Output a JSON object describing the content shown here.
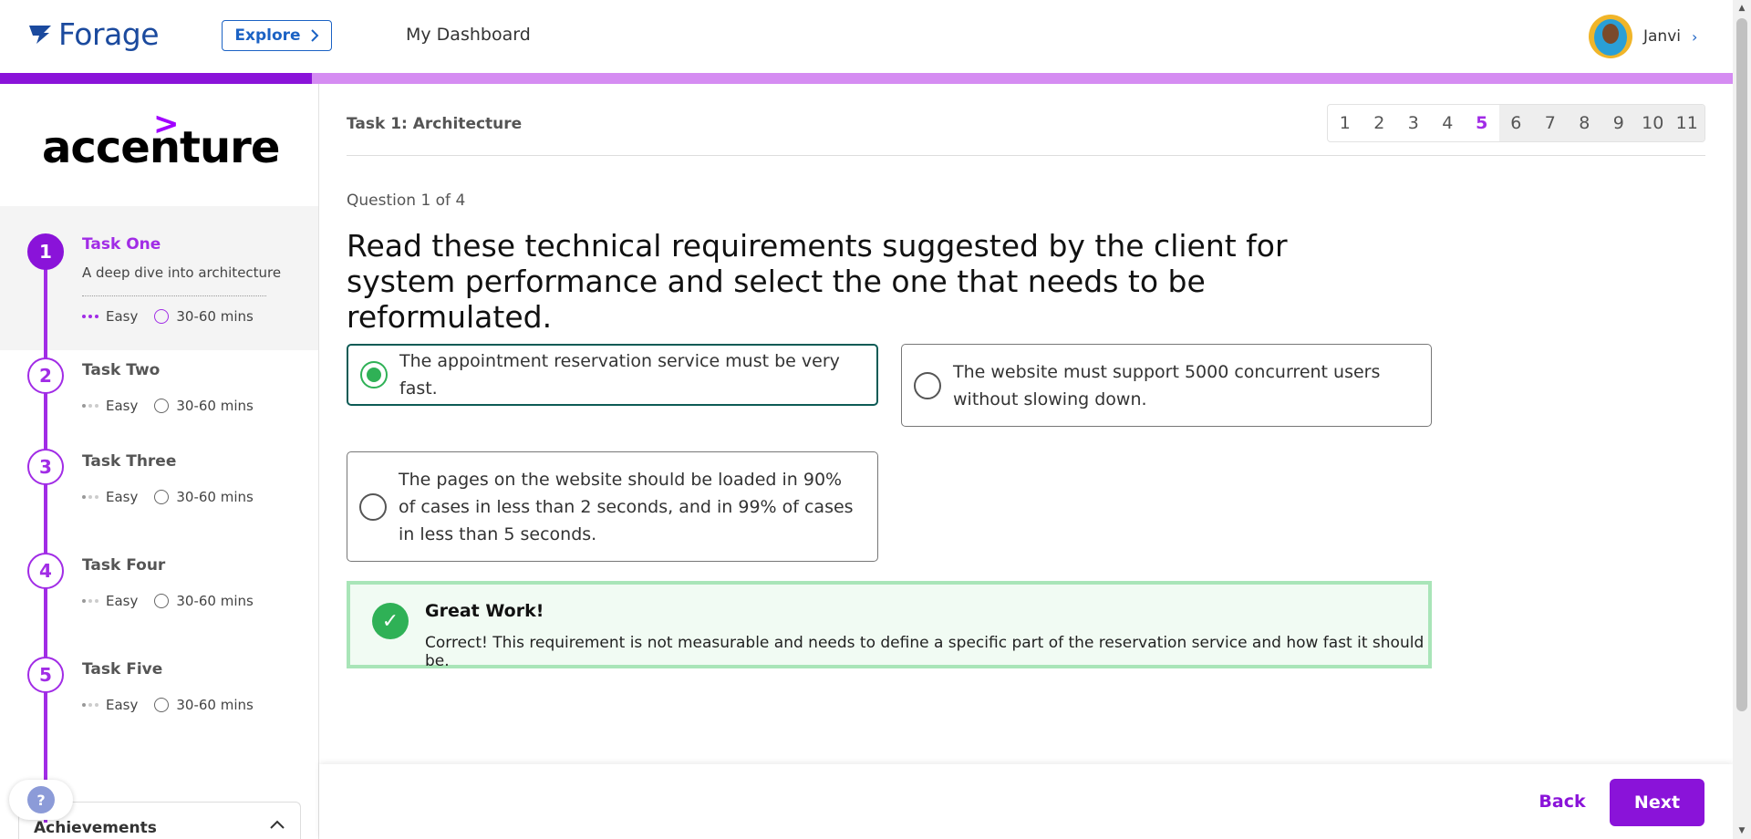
{
  "header": {
    "logo_text": "Forage",
    "explore_label": "Explore",
    "dashboard_label": "My Dashboard",
    "user_name": "Janvi"
  },
  "progress": {
    "fraction": 0.18
  },
  "sidebar": {
    "brand_mark": ">",
    "brand_name": "accenture",
    "tasks": [
      {
        "number": "1",
        "title": "Task One",
        "description": "A deep dive into architecture",
        "difficulty": "Easy",
        "duration": "30-60 mins"
      },
      {
        "number": "2",
        "title": "Task Two",
        "difficulty": "Easy",
        "duration": "30-60 mins"
      },
      {
        "number": "3",
        "title": "Task Three",
        "difficulty": "Easy",
        "duration": "30-60 mins"
      },
      {
        "number": "4",
        "title": "Task Four",
        "difficulty": "Easy",
        "duration": "30-60 mins"
      },
      {
        "number": "5",
        "title": "Task Five",
        "difficulty": "Easy",
        "duration": "30-60 mins"
      }
    ],
    "help_label": "?",
    "achievements_label": "Achievements"
  },
  "main": {
    "task_header": "Task 1: Architecture",
    "pages": [
      "1",
      "2",
      "3",
      "4",
      "5",
      "6",
      "7",
      "8",
      "9",
      "10",
      "11"
    ],
    "current_page": "5",
    "question_count": "Question 1 of 4",
    "question": "Read these technical requirements suggested by the client for system performance and select the one that needs to be reformulated.",
    "options": [
      {
        "text": "The appointment reservation service must be very fast.",
        "selected": true
      },
      {
        "text": "The website must support 5000 concurrent users without slowing down.",
        "selected": false
      },
      {
        "text": "The pages on the website should be loaded in 90% of cases in less than 2 seconds, and in 99% of cases in less than 5 seconds.",
        "selected": false
      }
    ],
    "feedback": {
      "title": "Great Work!",
      "text": "Correct! This requirement is not measurable and needs to define a specific part of the reservation service and how fast it should be."
    }
  },
  "footer": {
    "back_label": "Back",
    "next_label": "Next"
  },
  "colors": {
    "accent": "#8a13d9",
    "accent_light": "#d58cf2",
    "success": "#2fb156",
    "brand_blue": "#1b4a9e"
  }
}
